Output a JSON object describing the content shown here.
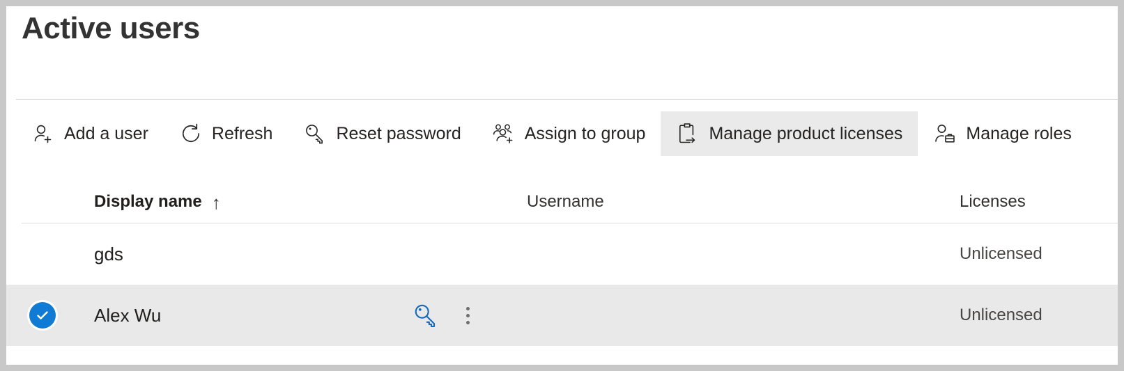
{
  "page": {
    "title": "Active users"
  },
  "colors": {
    "accent": "#0f7bd4",
    "command_hover_bg": "#eaeaea",
    "selected_row_bg": "#e9e9e9",
    "divider": "#dcdcdc",
    "text_primary": "#201f1e",
    "text_secondary": "#484644",
    "window_border": "#c8c8c8"
  },
  "commandbar": {
    "items": [
      {
        "label": "Add a user",
        "icon": "add-user-icon",
        "active": false
      },
      {
        "label": "Refresh",
        "icon": "refresh-icon",
        "active": false
      },
      {
        "label": "Reset password",
        "icon": "key-icon",
        "active": false
      },
      {
        "label": "Assign to group",
        "icon": "assign-to-group-icon",
        "active": false
      },
      {
        "label": "Manage product licenses",
        "icon": "clipboard-arrow-icon",
        "active": true
      },
      {
        "label": "Manage roles",
        "icon": "user-briefcase-icon",
        "active": false
      }
    ]
  },
  "table": {
    "columns": {
      "display_name": "Display name",
      "display_name_sort": "↑",
      "username": "Username",
      "licenses": "Licenses"
    },
    "rows": [
      {
        "display_name": "gds",
        "username": "",
        "licenses": "Unlicensed",
        "selected": false,
        "checkbox_state": "unchecked",
        "row_actions": []
      },
      {
        "display_name": "Alex Wu",
        "username": "",
        "licenses": "Unlicensed",
        "selected": true,
        "checkbox_state": "checked",
        "row_actions": [
          "reset-password-key-icon",
          "more-options-icon"
        ]
      }
    ]
  }
}
